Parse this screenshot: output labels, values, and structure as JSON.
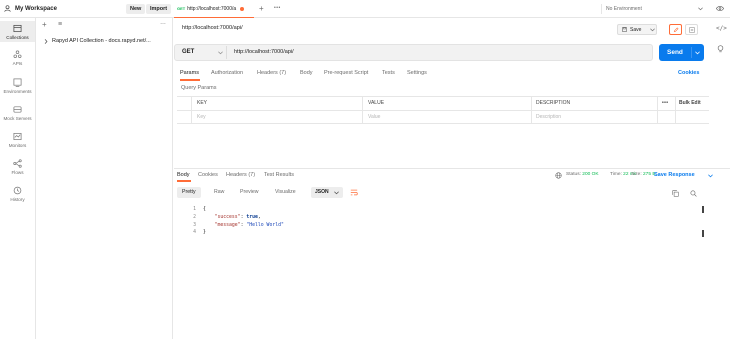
{
  "workspace": {
    "title": "My Workspace",
    "new_label": "New",
    "import_label": "Import"
  },
  "rail": {
    "items": [
      {
        "label": "Collections",
        "icon": "collections-icon",
        "active": true
      },
      {
        "label": "APIs",
        "icon": "apis-icon"
      },
      {
        "label": "Environments",
        "icon": "environments-icon"
      },
      {
        "label": "Mock Servers",
        "icon": "mock-servers-icon"
      },
      {
        "label": "Monitors",
        "icon": "monitors-icon"
      },
      {
        "label": "Flows",
        "icon": "flows-icon"
      },
      {
        "label": "History",
        "icon": "history-icon"
      }
    ]
  },
  "collections": {
    "add": "+",
    "filter": "≡",
    "more": "…",
    "item": "Rapyd API Collection - docs.rapyd.net/..."
  },
  "tabs": [
    {
      "method": "GET",
      "label": "http://localhost:7000/a",
      "unsaved": true
    }
  ],
  "tabs_controls": {
    "add": "+",
    "more": "•••"
  },
  "environment": {
    "label": "No Environment",
    "eye_icon": "eye-icon"
  },
  "request": {
    "title": "http://localhost:7000/api/",
    "save_label": "Save",
    "method": "GET",
    "url": "http://localhost:7000/api/",
    "send_label": "Send"
  },
  "request_tabs": [
    {
      "label": "Params",
      "active": true
    },
    {
      "label": "Authorization"
    },
    {
      "label": "Headers (7)"
    },
    {
      "label": "Body"
    },
    {
      "label": "Pre-request Script"
    },
    {
      "label": "Tests"
    },
    {
      "label": "Settings"
    }
  ],
  "cookies_label": "Cookies",
  "query_params": {
    "title": "Query Params",
    "headers": [
      "KEY",
      "VALUE",
      "DESCRIPTION"
    ],
    "more": "•••",
    "bulk_edit": "Bulk Edit",
    "placeholders": [
      "Key",
      "Value",
      "Description"
    ]
  },
  "response_tabs": [
    {
      "label": "Body",
      "active": true
    },
    {
      "label": "Cookies"
    },
    {
      "label": "Headers (7)"
    },
    {
      "label": "Test Results"
    }
  ],
  "response_meta": {
    "status_label": "Status:",
    "status_value": "200 OK",
    "time_label": "Time:",
    "time_value": "22 ms",
    "size_label": "Size:",
    "size_value": "275 B",
    "save_response": "Save Response"
  },
  "format_tabs": [
    {
      "label": "Pretty",
      "active": true
    },
    {
      "label": "Raw"
    },
    {
      "label": "Preview"
    },
    {
      "label": "Visualize"
    }
  ],
  "format_select": "JSON",
  "code_lines": [
    {
      "num": "1",
      "text": "{"
    },
    {
      "num": "2",
      "key": "\"success\"",
      "value": "true",
      "type": "bool"
    },
    {
      "num": "3",
      "key": "\"message\"",
      "value": "\"Hello World\"",
      "type": "string"
    },
    {
      "num": "4",
      "text": "}"
    }
  ],
  "colors": {
    "accent": "#ff6c37",
    "send": "#097bed",
    "status_ok": "#0cbb52"
  }
}
